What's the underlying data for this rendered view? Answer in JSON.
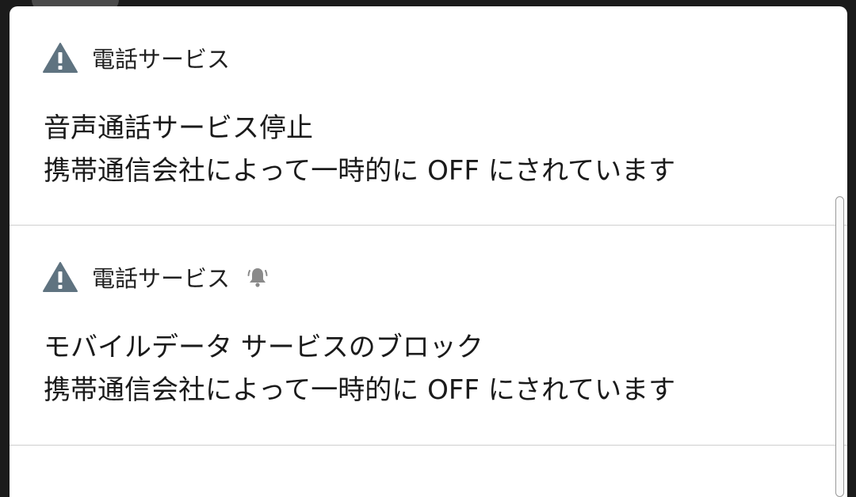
{
  "notifications": [
    {
      "app_name": "電話サービス",
      "app_icon": "warning-triangle-icon",
      "title": "音声通話サービス停止",
      "text": "携帯通信会社によって一時的に OFF にされています",
      "alert_icon": null
    },
    {
      "app_name": "電話サービス",
      "app_icon": "warning-triangle-icon",
      "title": "モバイルデータ サービスのブロック",
      "text": "携帯通信会社によって一時的に OFF にされています",
      "alert_icon": "bell-icon"
    }
  ],
  "colors": {
    "panel_background": "#ffffff",
    "warning_icon": "#5f7380",
    "divider": "#cfcfcf",
    "bell_icon": "#8a8a8a"
  }
}
